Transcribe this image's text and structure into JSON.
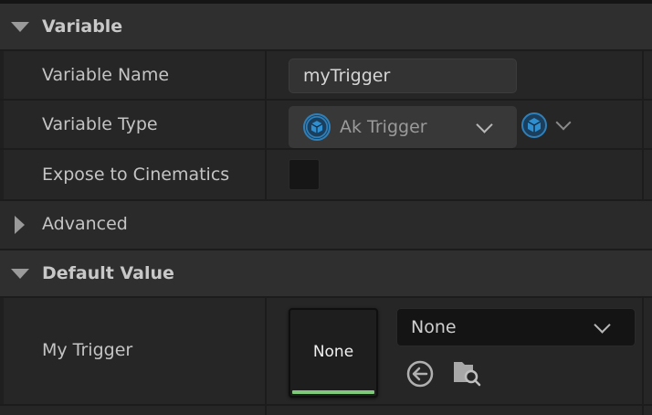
{
  "sections": {
    "variable": {
      "title": "Variable",
      "rows": {
        "name": {
          "label": "Variable Name",
          "value": "myTrigger"
        },
        "type": {
          "label": "Variable Type",
          "value": "Ak Trigger",
          "type_icon": "cube-icon",
          "container_icon": "cube-icon"
        },
        "expose": {
          "label": "Expose to Cinematics",
          "checked": false
        }
      },
      "advanced": {
        "label": "Advanced",
        "expanded": false
      }
    },
    "default_value": {
      "title": "Default Value",
      "row": {
        "label": "My Trigger",
        "thumbnail_text": "None",
        "asset_value": "None",
        "icons": [
          "use-selected-arrow-icon",
          "browse-folder-search-icon"
        ]
      }
    }
  },
  "colors": {
    "accent_blue": "#2f7fb8",
    "thumbnail_bar": "#7fc97a"
  }
}
